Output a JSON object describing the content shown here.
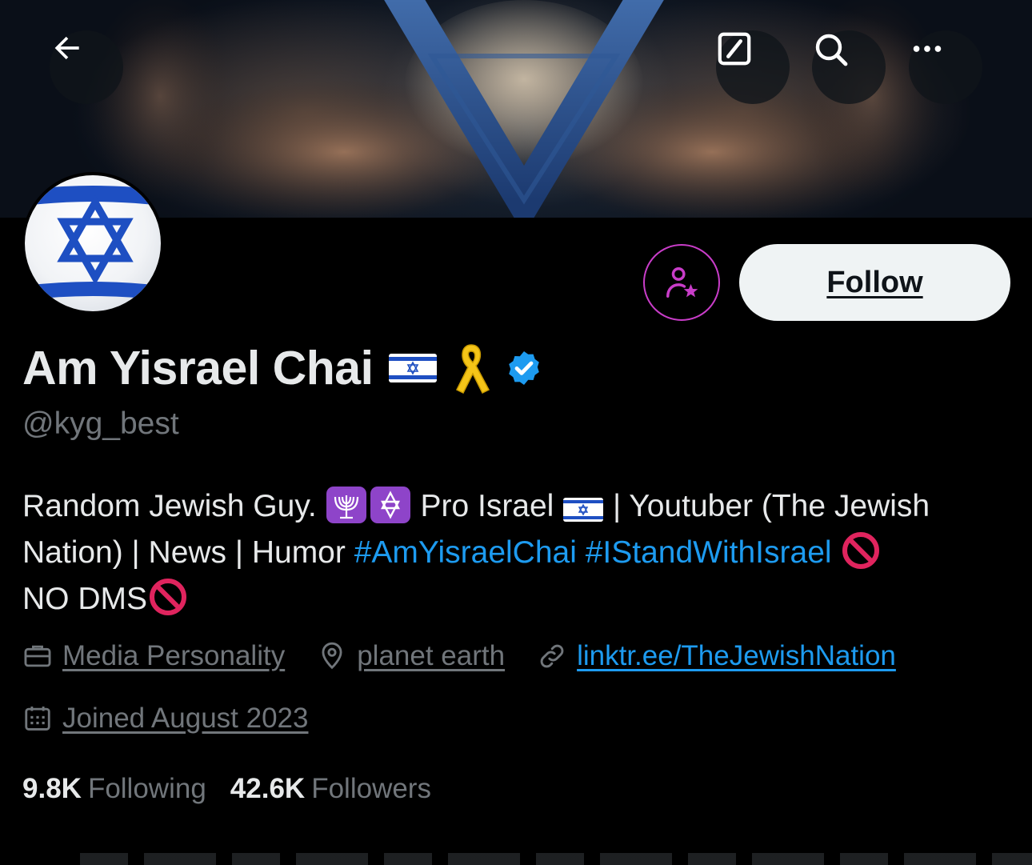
{
  "header": {
    "back_icon": "arrow-left-icon",
    "edit_icon": "compose-icon",
    "search_icon": "search-icon",
    "more_icon": "more-horizontal-icon"
  },
  "profile": {
    "display_name": "Am Yisrael Chai",
    "name_emojis": [
      "flag-israel",
      "yellow-ribbon"
    ],
    "verified": true,
    "handle": "@kyg_best",
    "follow_label": "Follow",
    "subscribe_icon": "person-star-icon",
    "bio": {
      "part1": "Random Jewish Guy.",
      "part2": "Pro Israel",
      "part3": "| Youtuber (The Jewish Nation) | News | Humor",
      "hashtag1": "#AmYisraelChai",
      "hashtag2": "#IStandWithIsrael",
      "part4": "NO DMS"
    },
    "meta": {
      "category": "Media Personality",
      "location": "planet earth",
      "website": "linktr.ee/TheJewishNation",
      "joined": "Joined August 2023"
    },
    "stats": {
      "following_count": "9.8K",
      "following_label": "Following",
      "followers_count": "42.6K",
      "followers_label": "Followers"
    }
  },
  "colors": {
    "accent": "#1d9bf0",
    "subscribe_ring": "#c93dc9",
    "muted": "#71767b",
    "text": "#e7e9ea"
  }
}
